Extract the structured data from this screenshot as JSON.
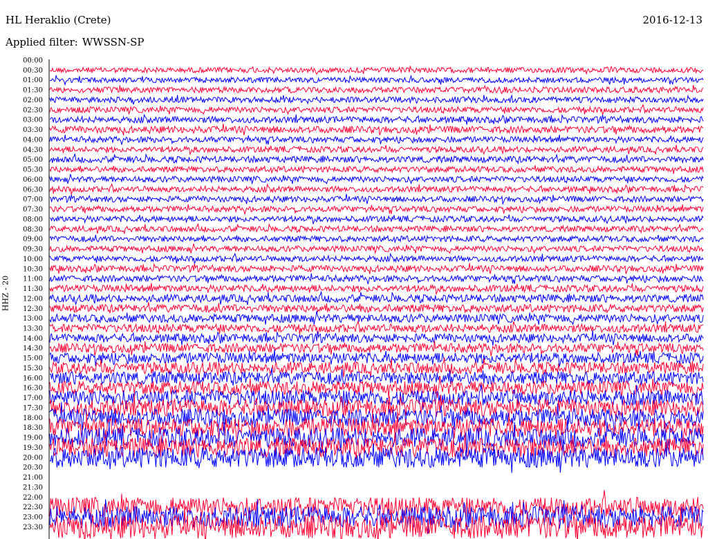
{
  "header": {
    "station": "HL Heraklio (Crete)",
    "date": "2016-12-13",
    "filter_label": "Applied filter:",
    "filter_value": "WWSSN-SP"
  },
  "chart_data": {
    "type": "line",
    "channel_label": "HHZ - 20",
    "colors": [
      "#0000ff",
      "#ff0033"
    ],
    "row_labels": [
      "00:00",
      "00:30",
      "01:00",
      "01:30",
      "02:00",
      "02:30",
      "03:00",
      "03:30",
      "04:00",
      "04:30",
      "05:00",
      "05:30",
      "06:00",
      "06:30",
      "07:00",
      "07:30",
      "08:00",
      "08:30",
      "09:00",
      "09:30",
      "10:00",
      "10:30",
      "11:00",
      "11:30",
      "12:00",
      "12:30",
      "13:00",
      "13:30",
      "14:00",
      "14:30",
      "15:00",
      "15:30",
      "16:00",
      "16:30",
      "17:00",
      "17:30",
      "18:00",
      "18:30",
      "19:00",
      "19:30",
      "20:00",
      "20:30",
      "21:00",
      "21:30",
      "22:00",
      "22:30",
      "23:00",
      "23:30"
    ],
    "trace_amplitude_by_row": [
      0,
      0.55,
      0.55,
      0.6,
      0.6,
      0.6,
      0.65,
      0.7,
      0.6,
      0.6,
      0.65,
      0.6,
      0.6,
      0.6,
      0.6,
      0.6,
      0.6,
      0.6,
      0.6,
      0.6,
      0.6,
      0.65,
      0.65,
      0.7,
      0.8,
      0.8,
      0.85,
      0.85,
      0.9,
      0.95,
      1.1,
      1.2,
      1.3,
      1.4,
      1.6,
      1.7,
      1.8,
      1.9,
      2.0,
      2.0,
      2.1,
      2.1,
      0,
      0,
      0,
      2.0,
      2.2,
      2.4
    ],
    "data_gap": {
      "start": "20:30",
      "end": "22:00"
    }
  }
}
